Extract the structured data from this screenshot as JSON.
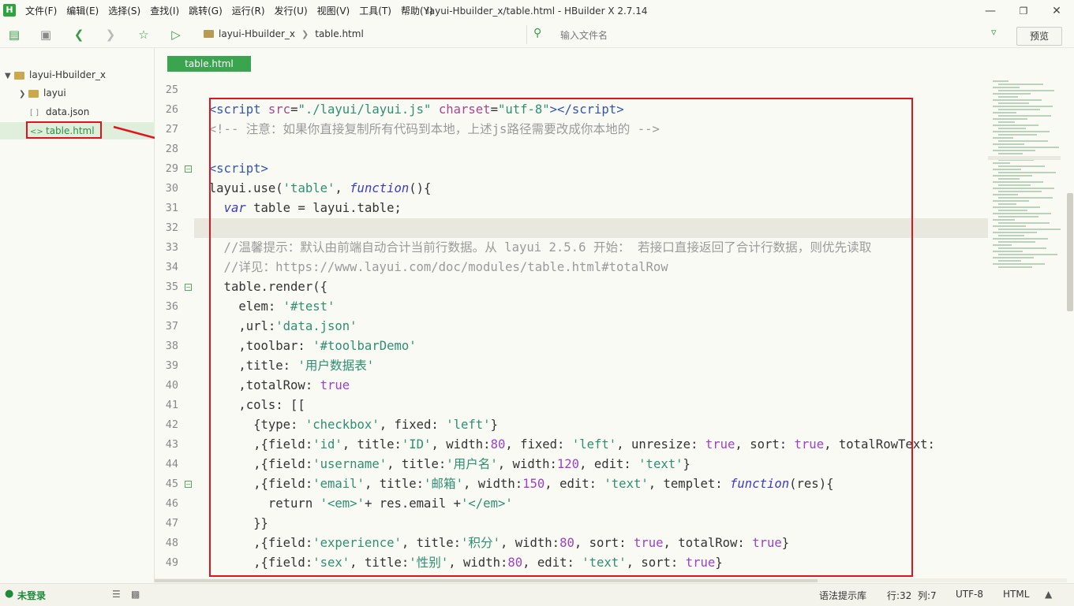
{
  "app": {
    "logo": "H",
    "window_title": "layui-Hbuilder_x/table.html - HBuilder X 2.7.14"
  },
  "menu": [
    "文件(F)",
    "编辑(E)",
    "选择(S)",
    "查找(I)",
    "跳转(G)",
    "运行(R)",
    "发行(U)",
    "视图(V)",
    "工具(T)",
    "帮助(Y)"
  ],
  "toolbar": {
    "breadcrumb": [
      "layui-Hbuilder_x",
      "table.html"
    ],
    "search_placeholder": "输入文件名",
    "preview_label": "预览"
  },
  "sidebar": {
    "project": "layui-Hbuilder_x",
    "items": [
      {
        "label": "layui",
        "type": "folder"
      },
      {
        "label": "data.json",
        "type": "json"
      },
      {
        "label": "table.html",
        "type": "html",
        "selected": true
      }
    ]
  },
  "tabs": [
    "table.html"
  ],
  "editor": {
    "line_numbers": [
      "25",
      "26",
      "27",
      "28",
      "29",
      "30",
      "31",
      "32",
      "33",
      "34",
      "35",
      "36",
      "37",
      "38",
      "39",
      "40",
      "41",
      "42",
      "43",
      "44",
      "45",
      "46",
      "47",
      "48",
      "49"
    ],
    "fold_lines": [
      "29",
      "35",
      "45"
    ],
    "current_line": "32"
  },
  "status": {
    "login": "未登录",
    "syntax": "语法提示库",
    "position": "行:32  列:7",
    "encoding": "UTF-8",
    "language": "HTML"
  },
  "colors": {
    "accent": "#3aa44e",
    "annotation": "#e0141e"
  }
}
